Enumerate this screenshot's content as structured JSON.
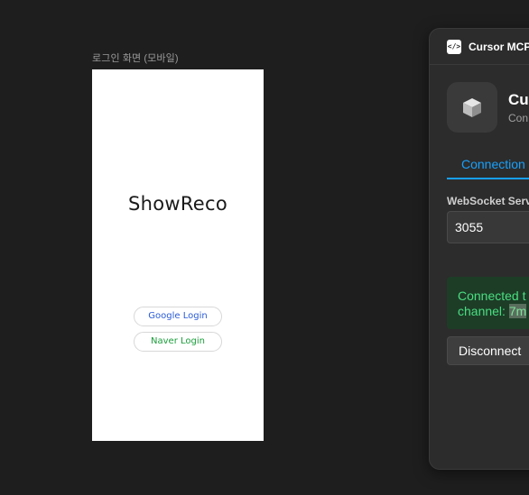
{
  "canvas": {
    "frame_label": "로그인 화면 (모바일)",
    "background": "#1e1e1e"
  },
  "mobile_frame": {
    "title": "ShowReco",
    "google_button": "Google Login",
    "naver_button": "Naver Login",
    "google_color": "#2a5bd7",
    "naver_color": "#1a9e3a"
  },
  "plugin": {
    "window_title": "Cursor MCP",
    "header_icon": "code-icon",
    "app_icon": "cube-icon",
    "app_name": "Cur",
    "app_subtitle": "Con",
    "active_tab": "Connection",
    "port_label": "WebSocket Serv",
    "port_value": "3055",
    "status_line1": "Connected t",
    "status_line2_prefix": "channel: ",
    "status_channel": "7m",
    "disconnect_button": "Disconnect",
    "accent_color": "#18a0fb",
    "status_color": "#4ade80"
  }
}
